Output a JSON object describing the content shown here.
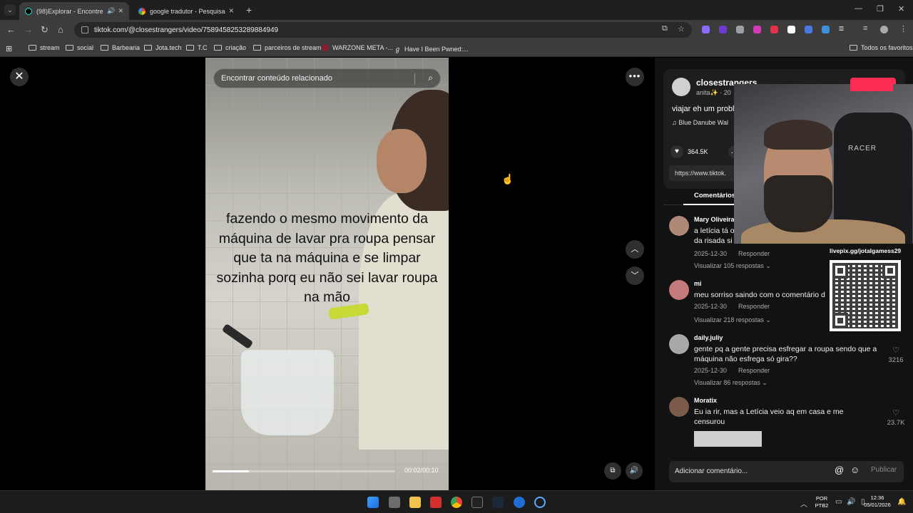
{
  "browser": {
    "tabs": [
      {
        "title": "(98)Explorar - Encontre seu",
        "active": true
      },
      {
        "title": "google tradutor - Pesquisa Goo",
        "active": false
      }
    ],
    "url": "tiktok.com/@closestrangers/video/7589458253289884949",
    "bookmarks": [
      "stream",
      "social",
      "Barbearia",
      "Jota.tech",
      "T.C",
      "criação",
      "parceiros de stream",
      "WARZONE META -...",
      "Have I Been Pwned:..."
    ],
    "all_bookmarks": "Todos os favoritos"
  },
  "video": {
    "search_placeholder": "Encontrar conteúdo relacionado",
    "caption": "fazendo o mesmo movimento da máquina de lavar pra roupa pensar que ta na máquina e se limpar sozinha porq eu não sei lavar roupa na mão",
    "time": "00:02/00:10",
    "progress": 0.2
  },
  "post": {
    "author": "closestrangers",
    "author_sub": "anita✨ · 20",
    "description": "viajar eh um probl",
    "music": "♫  Blue Danube Wal",
    "likes": "364.5K",
    "link": "https://www.tiktok.",
    "tab_label": "Comentários"
  },
  "comments": [
    {
      "user": "Mary Oliveira",
      "text": "a letícia tá o\nda risada si",
      "date": "2025-12-30",
      "reply": "Responder",
      "view": "Visualizar 105 respostas ⌄",
      "likes": ""
    },
    {
      "user": "mi",
      "text": "meu sorriso saindo com o comentário d",
      "date": "2025-12-30",
      "reply": "Responder",
      "view": "Visualizar 218 respostas ⌄",
      "likes": ""
    },
    {
      "user": "daily.juliy",
      "text": "gente pq a gente precisa esfregar a roupa sendo que a máquina não esfrega só gira??",
      "date": "2025-12-30",
      "reply": "Responder",
      "view": "Visualizar 86 respostas ⌄",
      "likes": "3216"
    },
    {
      "user": "Moratix",
      "text": "Eu ia rir, mas a Letícia veio aq em casa e me censurou",
      "likes": "23.7K"
    }
  ],
  "comment_input": {
    "placeholder": "Adicionar comentário...",
    "publish": "Publicar"
  },
  "overlay": {
    "qr_label": "livepix.gg/jotalgamess29",
    "chair_brand": "RACER"
  },
  "taskbar": {
    "lang": "POR\nPTB2",
    "time": "12:36",
    "date": "05/01/2026"
  }
}
